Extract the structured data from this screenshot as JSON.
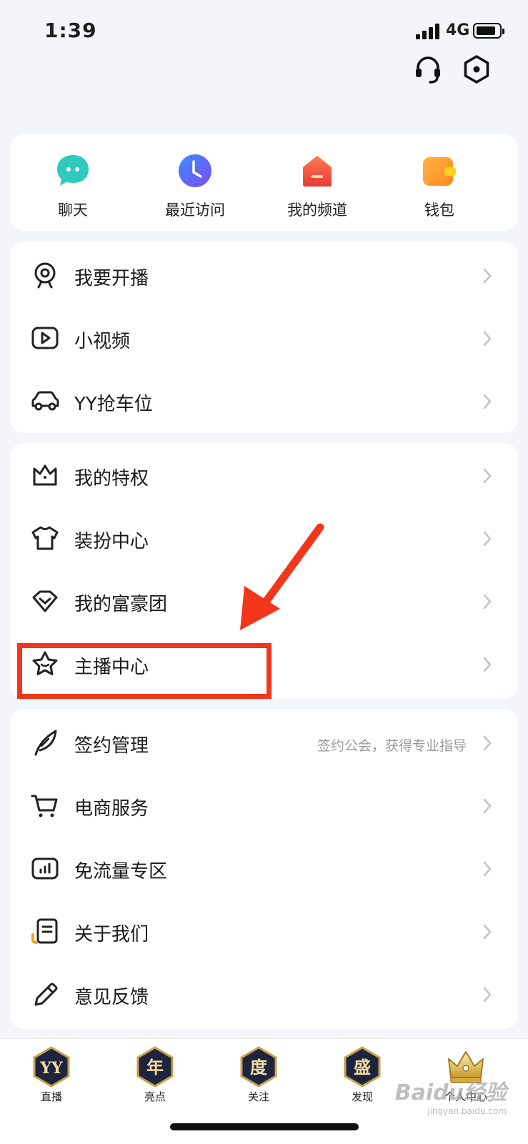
{
  "status": {
    "time": "1:39",
    "network": "4G"
  },
  "header": {
    "icons": [
      "headset-icon",
      "settings-icon"
    ]
  },
  "quick_actions": [
    {
      "label": "聊天",
      "icon": "chat-icon",
      "color": "#2fc9c0"
    },
    {
      "label": "最近访问",
      "icon": "clock-icon",
      "color": "#5b6cf2"
    },
    {
      "label": "我的频道",
      "icon": "channel-icon",
      "color": "#f2543d"
    },
    {
      "label": "钱包",
      "icon": "wallet-icon",
      "color": "#ffb020"
    }
  ],
  "section1": [
    {
      "label": "我要开播",
      "icon": "webcam-icon"
    },
    {
      "label": "小视频",
      "icon": "video-play-icon"
    },
    {
      "label": "YY抢车位",
      "icon": "car-icon"
    }
  ],
  "section2": [
    {
      "label": "我的特权",
      "icon": "crown-icon"
    },
    {
      "label": "装扮中心",
      "icon": "shirt-icon"
    },
    {
      "label": "我的富豪团",
      "icon": "diamond-icon"
    },
    {
      "label": "主播中心",
      "icon": "star-icon"
    }
  ],
  "section3": [
    {
      "label": "签约管理",
      "icon": "feather-icon",
      "sub": "签约公会，获得专业指导"
    },
    {
      "label": "电商服务",
      "icon": "cart-icon"
    },
    {
      "label": "免流量专区",
      "icon": "data-chart-icon"
    },
    {
      "label": "关于我们",
      "icon": "document-icon"
    },
    {
      "label": "意见反馈",
      "icon": "pencil-icon"
    }
  ],
  "tabs": [
    {
      "label": "直播",
      "glyph": "YY"
    },
    {
      "label": "亮点",
      "glyph": "年"
    },
    {
      "label": "关注",
      "glyph": "度"
    },
    {
      "label": "发现",
      "glyph": "盛"
    },
    {
      "label": "个人中心",
      "glyph": ""
    }
  ],
  "watermark": {
    "brand": "Baidu经验",
    "url": "jingyan.baidu.com"
  },
  "colors": {
    "annotation": "#f2361c",
    "card": "#ffffff",
    "background": "#f3f5f9"
  }
}
